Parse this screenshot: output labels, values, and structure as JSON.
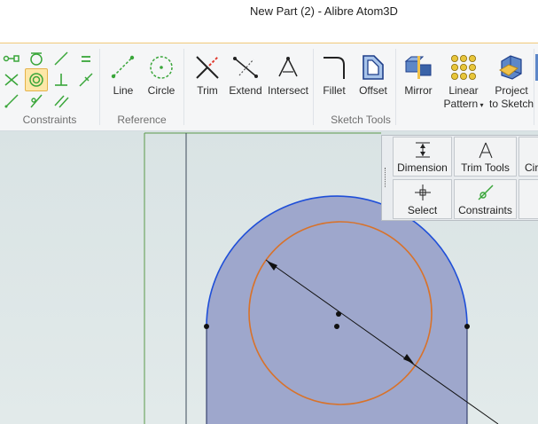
{
  "window": {
    "title": "New Part (2) - Alibre Atom3D"
  },
  "ribbon": {
    "groups": {
      "constraints": {
        "label": "Constraints"
      },
      "reference": {
        "label": "Reference"
      },
      "sketch_tools": {
        "label": "Sketch Tools"
      }
    },
    "buttons": {
      "line": "Line",
      "circle": "Circle",
      "trim": "Trim",
      "extend": "Extend",
      "intersect": "Intersect",
      "fillet": "Fillet",
      "offset": "Offset",
      "mirror": "Mirror",
      "linear_pattern_1": "Linear",
      "linear_pattern_2": "Pattern",
      "project_1": "Project",
      "project_2": "to Sketch"
    }
  },
  "palette": {
    "dimension": "Dimension",
    "trim_tools": "Trim Tools",
    "circle_cut": "Cir",
    "select": "Select",
    "constraints": "Constraints"
  },
  "colors": {
    "accent": "#f0c97a",
    "profile_fill": "#9ea7cc",
    "arc_blue": "#1f4fd8",
    "circle_orange": "#d8722a",
    "constraint_green": "#3aa63a"
  }
}
